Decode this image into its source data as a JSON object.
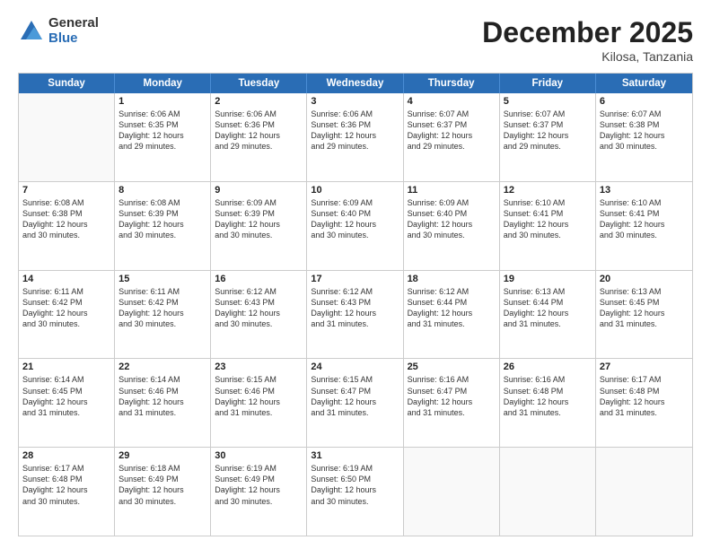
{
  "logo": {
    "general": "General",
    "blue": "Blue"
  },
  "header": {
    "month": "December 2025",
    "location": "Kilosa, Tanzania"
  },
  "days": [
    "Sunday",
    "Monday",
    "Tuesday",
    "Wednesday",
    "Thursday",
    "Friday",
    "Saturday"
  ],
  "rows": [
    [
      {
        "day": "",
        "info": ""
      },
      {
        "day": "1",
        "info": "Sunrise: 6:06 AM\nSunset: 6:35 PM\nDaylight: 12 hours\nand 29 minutes."
      },
      {
        "day": "2",
        "info": "Sunrise: 6:06 AM\nSunset: 6:36 PM\nDaylight: 12 hours\nand 29 minutes."
      },
      {
        "day": "3",
        "info": "Sunrise: 6:06 AM\nSunset: 6:36 PM\nDaylight: 12 hours\nand 29 minutes."
      },
      {
        "day": "4",
        "info": "Sunrise: 6:07 AM\nSunset: 6:37 PM\nDaylight: 12 hours\nand 29 minutes."
      },
      {
        "day": "5",
        "info": "Sunrise: 6:07 AM\nSunset: 6:37 PM\nDaylight: 12 hours\nand 29 minutes."
      },
      {
        "day": "6",
        "info": "Sunrise: 6:07 AM\nSunset: 6:38 PM\nDaylight: 12 hours\nand 30 minutes."
      }
    ],
    [
      {
        "day": "7",
        "info": "Sunrise: 6:08 AM\nSunset: 6:38 PM\nDaylight: 12 hours\nand 30 minutes."
      },
      {
        "day": "8",
        "info": "Sunrise: 6:08 AM\nSunset: 6:39 PM\nDaylight: 12 hours\nand 30 minutes."
      },
      {
        "day": "9",
        "info": "Sunrise: 6:09 AM\nSunset: 6:39 PM\nDaylight: 12 hours\nand 30 minutes."
      },
      {
        "day": "10",
        "info": "Sunrise: 6:09 AM\nSunset: 6:40 PM\nDaylight: 12 hours\nand 30 minutes."
      },
      {
        "day": "11",
        "info": "Sunrise: 6:09 AM\nSunset: 6:40 PM\nDaylight: 12 hours\nand 30 minutes."
      },
      {
        "day": "12",
        "info": "Sunrise: 6:10 AM\nSunset: 6:41 PM\nDaylight: 12 hours\nand 30 minutes."
      },
      {
        "day": "13",
        "info": "Sunrise: 6:10 AM\nSunset: 6:41 PM\nDaylight: 12 hours\nand 30 minutes."
      }
    ],
    [
      {
        "day": "14",
        "info": "Sunrise: 6:11 AM\nSunset: 6:42 PM\nDaylight: 12 hours\nand 30 minutes."
      },
      {
        "day": "15",
        "info": "Sunrise: 6:11 AM\nSunset: 6:42 PM\nDaylight: 12 hours\nand 30 minutes."
      },
      {
        "day": "16",
        "info": "Sunrise: 6:12 AM\nSunset: 6:43 PM\nDaylight: 12 hours\nand 30 minutes."
      },
      {
        "day": "17",
        "info": "Sunrise: 6:12 AM\nSunset: 6:43 PM\nDaylight: 12 hours\nand 31 minutes."
      },
      {
        "day": "18",
        "info": "Sunrise: 6:12 AM\nSunset: 6:44 PM\nDaylight: 12 hours\nand 31 minutes."
      },
      {
        "day": "19",
        "info": "Sunrise: 6:13 AM\nSunset: 6:44 PM\nDaylight: 12 hours\nand 31 minutes."
      },
      {
        "day": "20",
        "info": "Sunrise: 6:13 AM\nSunset: 6:45 PM\nDaylight: 12 hours\nand 31 minutes."
      }
    ],
    [
      {
        "day": "21",
        "info": "Sunrise: 6:14 AM\nSunset: 6:45 PM\nDaylight: 12 hours\nand 31 minutes."
      },
      {
        "day": "22",
        "info": "Sunrise: 6:14 AM\nSunset: 6:46 PM\nDaylight: 12 hours\nand 31 minutes."
      },
      {
        "day": "23",
        "info": "Sunrise: 6:15 AM\nSunset: 6:46 PM\nDaylight: 12 hours\nand 31 minutes."
      },
      {
        "day": "24",
        "info": "Sunrise: 6:15 AM\nSunset: 6:47 PM\nDaylight: 12 hours\nand 31 minutes."
      },
      {
        "day": "25",
        "info": "Sunrise: 6:16 AM\nSunset: 6:47 PM\nDaylight: 12 hours\nand 31 minutes."
      },
      {
        "day": "26",
        "info": "Sunrise: 6:16 AM\nSunset: 6:48 PM\nDaylight: 12 hours\nand 31 minutes."
      },
      {
        "day": "27",
        "info": "Sunrise: 6:17 AM\nSunset: 6:48 PM\nDaylight: 12 hours\nand 31 minutes."
      }
    ],
    [
      {
        "day": "28",
        "info": "Sunrise: 6:17 AM\nSunset: 6:48 PM\nDaylight: 12 hours\nand 30 minutes."
      },
      {
        "day": "29",
        "info": "Sunrise: 6:18 AM\nSunset: 6:49 PM\nDaylight: 12 hours\nand 30 minutes."
      },
      {
        "day": "30",
        "info": "Sunrise: 6:19 AM\nSunset: 6:49 PM\nDaylight: 12 hours\nand 30 minutes."
      },
      {
        "day": "31",
        "info": "Sunrise: 6:19 AM\nSunset: 6:50 PM\nDaylight: 12 hours\nand 30 minutes."
      },
      {
        "day": "",
        "info": ""
      },
      {
        "day": "",
        "info": ""
      },
      {
        "day": "",
        "info": ""
      }
    ]
  ]
}
